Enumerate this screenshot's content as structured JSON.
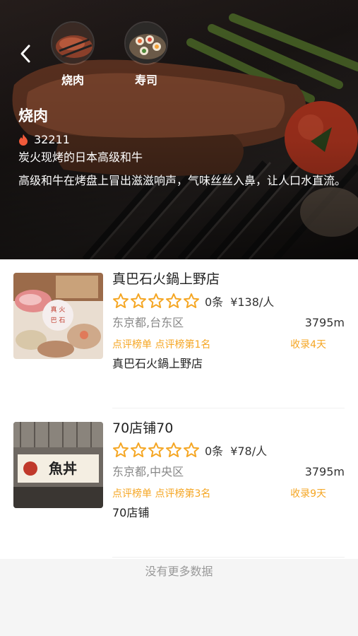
{
  "hero": {
    "back_icon": "chevron-left-icon",
    "categories": [
      {
        "label": "烧肉"
      },
      {
        "label": "寿司"
      }
    ],
    "title": "烧肉",
    "stat_icon": "fire-icon",
    "stat_count": "32211",
    "subtitle": "炭火现烤的日本高级和牛",
    "description": "高级和牛在烤盘上冒出滋滋响声，气味丝丝入鼻，让人口水直流。"
  },
  "restaurants": [
    {
      "name": "真巴石火鍋上野店",
      "stars": 5,
      "rating_filled": 0,
      "reviews": "0条",
      "price": "¥138/人",
      "area": "东京都,台东区",
      "distance": "3795m",
      "ranking": "点评榜单 点评榜第1名",
      "saved": "收录4天",
      "tag": "真巴石火鍋上野店"
    },
    {
      "name": "70店铺70",
      "stars": 5,
      "rating_filled": 0,
      "reviews": "0条",
      "price": "¥78/人",
      "area": "东京都,中央区",
      "distance": "3795m",
      "ranking": "点评榜单 点评榜第3名",
      "saved": "收录9天",
      "tag": "70店铺"
    }
  ],
  "footer": {
    "text": "没有更多数据"
  },
  "colors": {
    "accent": "#f5a623",
    "muted": "#888888"
  }
}
